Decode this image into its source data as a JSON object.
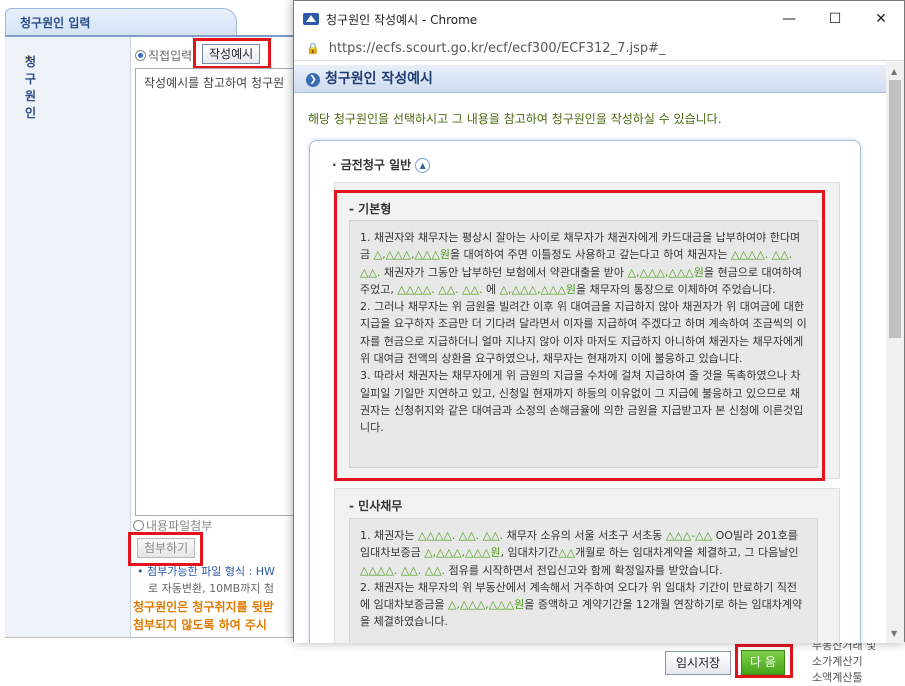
{
  "background": {
    "tab_title": "청구원인 입력",
    "field_label": "청구원인",
    "radio_direct": "직접입력",
    "example_button": "작성예시",
    "textarea_text": "작성예시를 참고하여 청구원",
    "radio_file": "내용파일첨부",
    "attach_button": "첨부하기",
    "note_prefix": "첨부가능한 파일 형식 : HW",
    "note_line2": "로 자동변환, 10MB까지 첨",
    "warning1": "청구원인은 청구취지를 뒷받",
    "warning2": "첨부되지 않도록 하여 주시",
    "save_button": "임시저장",
    "next_button": "다 음",
    "right_links": [
      "부동산거래 및",
      "소가계산기",
      "소액계산툴"
    ]
  },
  "popup": {
    "window_title": "청구원인 작성예시 - Chrome",
    "url": "https://ecfs.scourt.go.kr/ecf/ecf300/ECF312_7.jsp#_",
    "heading": "청구원인 작성예시",
    "intro": "해당 청구원인을 선택하시고 그 내용을 참고하여 청구원인을 작성하실 수 있습니다.",
    "category": "· 금전청구 일반",
    "section1_title": "- 기본형",
    "section1_paragraphs": [
      [
        "1. 채권자와 채무자는 평상시 잘아는 사이로 채무자가 채권자에게 카드대금을 납부하여야 한다며 금 ",
        "△,△△△,△△△원",
        "을 대여하여 주면 이틀정도 사용하고 갚는다고 하여 채권자는 ",
        "△△△△. △△. △△.",
        " 채권자가 그동안 납부하던 보험에서 약관대출을 받아 ",
        "△,△△△,△△△원",
        "을 현금으로 대여하여 주었고, ",
        "△△△△. △△. △△.",
        " 에 ",
        "△,△△△,△△△원",
        "을 채무자의 통장으로 이체하여 주었습니다."
      ],
      [
        "2. 그러나 채무자는 위 금원을 빌려간 이후 위 대여금을 지급하지 않아 채권자가 위 대여금에 대한 지급을 요구하자 조금만 더 기다려 달라면서 이자를 지급하여 주겠다고 하며 계속하여 조금씩의 이자를 현금으로 지급하더니 얼마 지나지 않아 이자 마저도 지급하지 아니하여 채권자는 채무자에게 위 대여금 전액의 상환을 요구하였으나, 채무자는 현재까지 이에 불응하고 있습니다."
      ],
      [
        "3. 따라서 채권자는 채무자에게 위 금원의 지급을 수차에 걸쳐 지급하여 줄 것을 독촉하였으나 차일피일 기일만 지연하고 있고, 신청일 현재까지 하등의 이유없이 그 지급에 불응하고 있으므로 채권자는 신청취지와 같은 대여금과 소정의 손해금율에 의한 금원을 지급받고자 본 신청에 이른것입니다."
      ]
    ],
    "section2_title": "- 민사채무",
    "section2_paragraphs": [
      [
        "1. 채권자는 ",
        "△△△△. △△. △△.",
        " 채무자 소유의 서울 서초구 서초동 ",
        "△△△-△△",
        " OO빌라 201호를 임대차보증금 ",
        "△,△△△,△△△원",
        ", 임대차기간",
        "△△",
        "개월로 하는 임대차계약을 체결하고, 그 다음날인 ",
        "△△△△. △△. △△.",
        " 점유를 시작하면서 전입신고와 함께 확정일자를 받았습니다."
      ],
      [
        "2. 채권자는 채무자의 위 부동산에서 계속해서 거주하여 오다가 위 임대차 기간이 만료하기 직전에 임대차보증금을 ",
        "△,△△△,△△△원",
        "을 증액하고 계약기간을 12개월 연장하기로 하는 임대차계약을 체결하였습니다."
      ]
    ]
  }
}
